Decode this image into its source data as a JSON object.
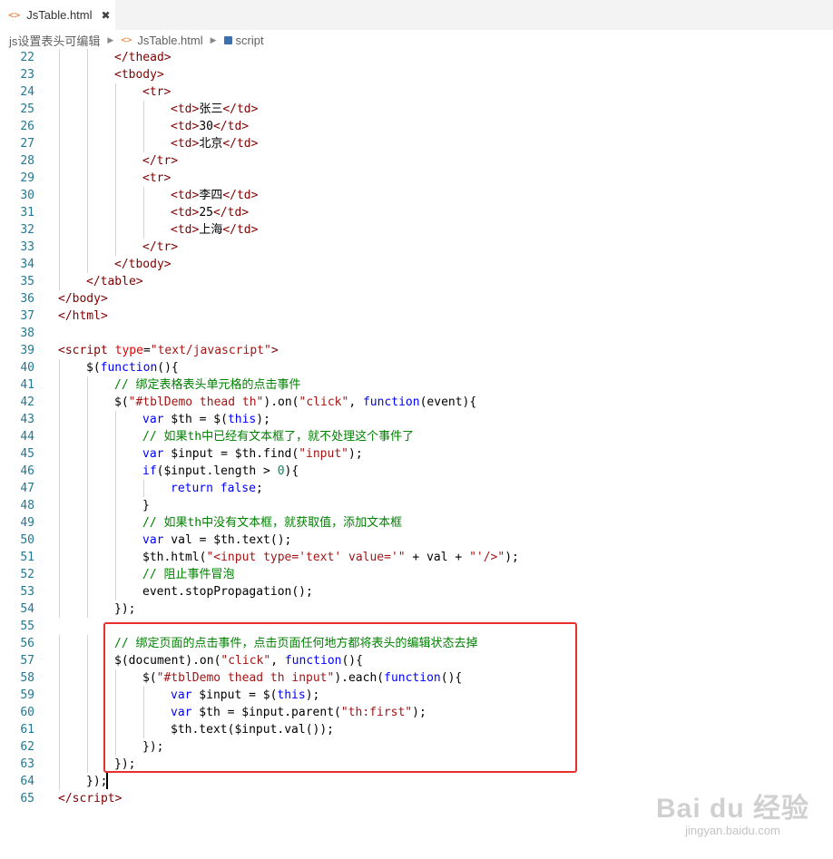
{
  "tab": {
    "icon": "<>",
    "title": "JsTable.html",
    "close": "✖"
  },
  "breadcrumb": [
    "js设置表头可编辑",
    "JsTable.html",
    "script"
  ],
  "breadcrumb_icons": {
    "file": "<>",
    "symbol": "cube-icon"
  },
  "colors": {
    "tag": "#800000",
    "attr": "#e50000",
    "string": "#a31515",
    "keyword": "#0000ff",
    "comment": "#008000",
    "line_number": "#237893",
    "highlight_box": "#e8302a"
  },
  "lines": [
    {
      "n": "22",
      "indent": 2,
      "tokens": [
        [
          "t",
          "</thead>"
        ]
      ]
    },
    {
      "n": "23",
      "indent": 2,
      "tokens": [
        [
          "t",
          "<tbody>"
        ]
      ]
    },
    {
      "n": "24",
      "indent": 3,
      "tokens": [
        [
          "t",
          "<tr>"
        ]
      ]
    },
    {
      "n": "25",
      "indent": 4,
      "tokens": [
        [
          "t",
          "<td>"
        ],
        [
          "x",
          "张三"
        ],
        [
          "t",
          "</td>"
        ]
      ]
    },
    {
      "n": "26",
      "indent": 4,
      "tokens": [
        [
          "t",
          "<td>"
        ],
        [
          "x",
          "30"
        ],
        [
          "t",
          "</td>"
        ]
      ]
    },
    {
      "n": "27",
      "indent": 4,
      "tokens": [
        [
          "t",
          "<td>"
        ],
        [
          "x",
          "北京"
        ],
        [
          "t",
          "</td>"
        ]
      ]
    },
    {
      "n": "28",
      "indent": 3,
      "tokens": [
        [
          "t",
          "</tr>"
        ]
      ]
    },
    {
      "n": "29",
      "indent": 3,
      "tokens": [
        [
          "t",
          "<tr>"
        ]
      ]
    },
    {
      "n": "30",
      "indent": 4,
      "tokens": [
        [
          "t",
          "<td>"
        ],
        [
          "x",
          "李四"
        ],
        [
          "t",
          "</td>"
        ]
      ]
    },
    {
      "n": "31",
      "indent": 4,
      "tokens": [
        [
          "t",
          "<td>"
        ],
        [
          "x",
          "25"
        ],
        [
          "t",
          "</td>"
        ]
      ]
    },
    {
      "n": "32",
      "indent": 4,
      "tokens": [
        [
          "t",
          "<td>"
        ],
        [
          "x",
          "上海"
        ],
        [
          "t",
          "</td>"
        ]
      ]
    },
    {
      "n": "33",
      "indent": 3,
      "tokens": [
        [
          "t",
          "</tr>"
        ]
      ]
    },
    {
      "n": "34",
      "indent": 2,
      "tokens": [
        [
          "t",
          "</tbody>"
        ]
      ]
    },
    {
      "n": "35",
      "indent": 1,
      "tokens": [
        [
          "t",
          "</table>"
        ]
      ]
    },
    {
      "n": "36",
      "indent": 0,
      "tokens": [
        [
          "t",
          "</body>"
        ]
      ]
    },
    {
      "n": "37",
      "indent": 0,
      "tokens": [
        [
          "t",
          "</html>"
        ]
      ]
    },
    {
      "n": "38",
      "indent": 0,
      "tokens": []
    },
    {
      "n": "39",
      "indent": 0,
      "tokens": [
        [
          "t",
          "<script "
        ],
        [
          "a",
          "type"
        ],
        [
          "x",
          "="
        ],
        [
          "s",
          "\"text/javascript\""
        ],
        [
          "t",
          ">"
        ]
      ]
    },
    {
      "n": "40",
      "indent": 1,
      "tokens": [
        [
          "x",
          "$("
        ],
        [
          "k",
          "function"
        ],
        [
          "x",
          "(){"
        ]
      ]
    },
    {
      "n": "41",
      "indent": 2,
      "tokens": [
        [
          "c",
          "// 绑定表格表头单元格的点击事件"
        ]
      ]
    },
    {
      "n": "42",
      "indent": 2,
      "tokens": [
        [
          "x",
          "$("
        ],
        [
          "s",
          "\"#tblDemo thead th\""
        ],
        [
          "x",
          ").on("
        ],
        [
          "s",
          "\"click\""
        ],
        [
          "x",
          ", "
        ],
        [
          "k",
          "function"
        ],
        [
          "x",
          "(event){"
        ]
      ]
    },
    {
      "n": "43",
      "indent": 3,
      "tokens": [
        [
          "k",
          "var"
        ],
        [
          "x",
          " $th = $("
        ],
        [
          "k",
          "this"
        ],
        [
          "x",
          ");"
        ]
      ]
    },
    {
      "n": "44",
      "indent": 3,
      "tokens": [
        [
          "c",
          "// 如果th中已经有文本框了，就不处理这个事件了"
        ]
      ]
    },
    {
      "n": "45",
      "indent": 3,
      "tokens": [
        [
          "k",
          "var"
        ],
        [
          "x",
          " $input = $th.find("
        ],
        [
          "s",
          "\"input\""
        ],
        [
          "x",
          ");"
        ]
      ]
    },
    {
      "n": "46",
      "indent": 3,
      "tokens": [
        [
          "k",
          "if"
        ],
        [
          "x",
          "($input.length > "
        ],
        [
          "n",
          "0"
        ],
        [
          "x",
          "){"
        ]
      ]
    },
    {
      "n": "47",
      "indent": 4,
      "tokens": [
        [
          "k",
          "return"
        ],
        [
          "x",
          " "
        ],
        [
          "k",
          "false"
        ],
        [
          "x",
          ";"
        ]
      ]
    },
    {
      "n": "48",
      "indent": 3,
      "tokens": [
        [
          "x",
          "}"
        ]
      ]
    },
    {
      "n": "49",
      "indent": 3,
      "tokens": [
        [
          "c",
          "// 如果th中没有文本框，就获取值，添加文本框"
        ]
      ]
    },
    {
      "n": "50",
      "indent": 3,
      "tokens": [
        [
          "k",
          "var"
        ],
        [
          "x",
          " val = $th.text();"
        ]
      ]
    },
    {
      "n": "51",
      "indent": 3,
      "tokens": [
        [
          "x",
          "$th.html("
        ],
        [
          "s",
          "\"<input type='text' value='\""
        ],
        [
          "x",
          " + val + "
        ],
        [
          "s",
          "\"'/>\""
        ],
        [
          "x",
          ");"
        ]
      ]
    },
    {
      "n": "52",
      "indent": 3,
      "tokens": [
        [
          "c",
          "// 阻止事件冒泡"
        ]
      ]
    },
    {
      "n": "53",
      "indent": 3,
      "tokens": [
        [
          "x",
          "event.stopPropagation();"
        ]
      ]
    },
    {
      "n": "54",
      "indent": 2,
      "tokens": [
        [
          "x",
          "});"
        ]
      ]
    },
    {
      "n": "55",
      "indent": 0,
      "tokens": []
    },
    {
      "n": "56",
      "indent": 2,
      "tokens": [
        [
          "c",
          "// 绑定页面的点击事件，点击页面任何地方都将表头的编辑状态去掉"
        ]
      ]
    },
    {
      "n": "57",
      "indent": 2,
      "tokens": [
        [
          "x",
          "$(document).on("
        ],
        [
          "s",
          "\"click\""
        ],
        [
          "x",
          ", "
        ],
        [
          "k",
          "function"
        ],
        [
          "x",
          "(){"
        ]
      ]
    },
    {
      "n": "58",
      "indent": 3,
      "tokens": [
        [
          "x",
          "$("
        ],
        [
          "s",
          "\"#tblDemo thead th input\""
        ],
        [
          "x",
          ").each("
        ],
        [
          "k",
          "function"
        ],
        [
          "x",
          "(){"
        ]
      ]
    },
    {
      "n": "59",
      "indent": 4,
      "tokens": [
        [
          "k",
          "var"
        ],
        [
          "x",
          " $input = $("
        ],
        [
          "k",
          "this"
        ],
        [
          "x",
          ");"
        ]
      ]
    },
    {
      "n": "60",
      "indent": 4,
      "tokens": [
        [
          "k",
          "var"
        ],
        [
          "x",
          " $th = $input.parent("
        ],
        [
          "s",
          "\"th:first\""
        ],
        [
          "x",
          ");"
        ]
      ]
    },
    {
      "n": "61",
      "indent": 4,
      "tokens": [
        [
          "x",
          "$th.text($input.val());"
        ]
      ]
    },
    {
      "n": "62",
      "indent": 3,
      "tokens": [
        [
          "x",
          "});"
        ]
      ]
    },
    {
      "n": "63",
      "indent": 2,
      "tokens": [
        [
          "x",
          "});"
        ]
      ]
    },
    {
      "n": "64",
      "indent": 1,
      "tokens": [
        [
          "x",
          "});"
        ]
      ]
    },
    {
      "n": "65",
      "indent": 0,
      "tokens": [
        [
          "t",
          "</"
        ],
        [
          "t",
          "script"
        ],
        [
          "t",
          ">"
        ]
      ]
    }
  ],
  "watermark": {
    "logo": "Bai du 经验",
    "url": "jingyan.baidu.com"
  }
}
